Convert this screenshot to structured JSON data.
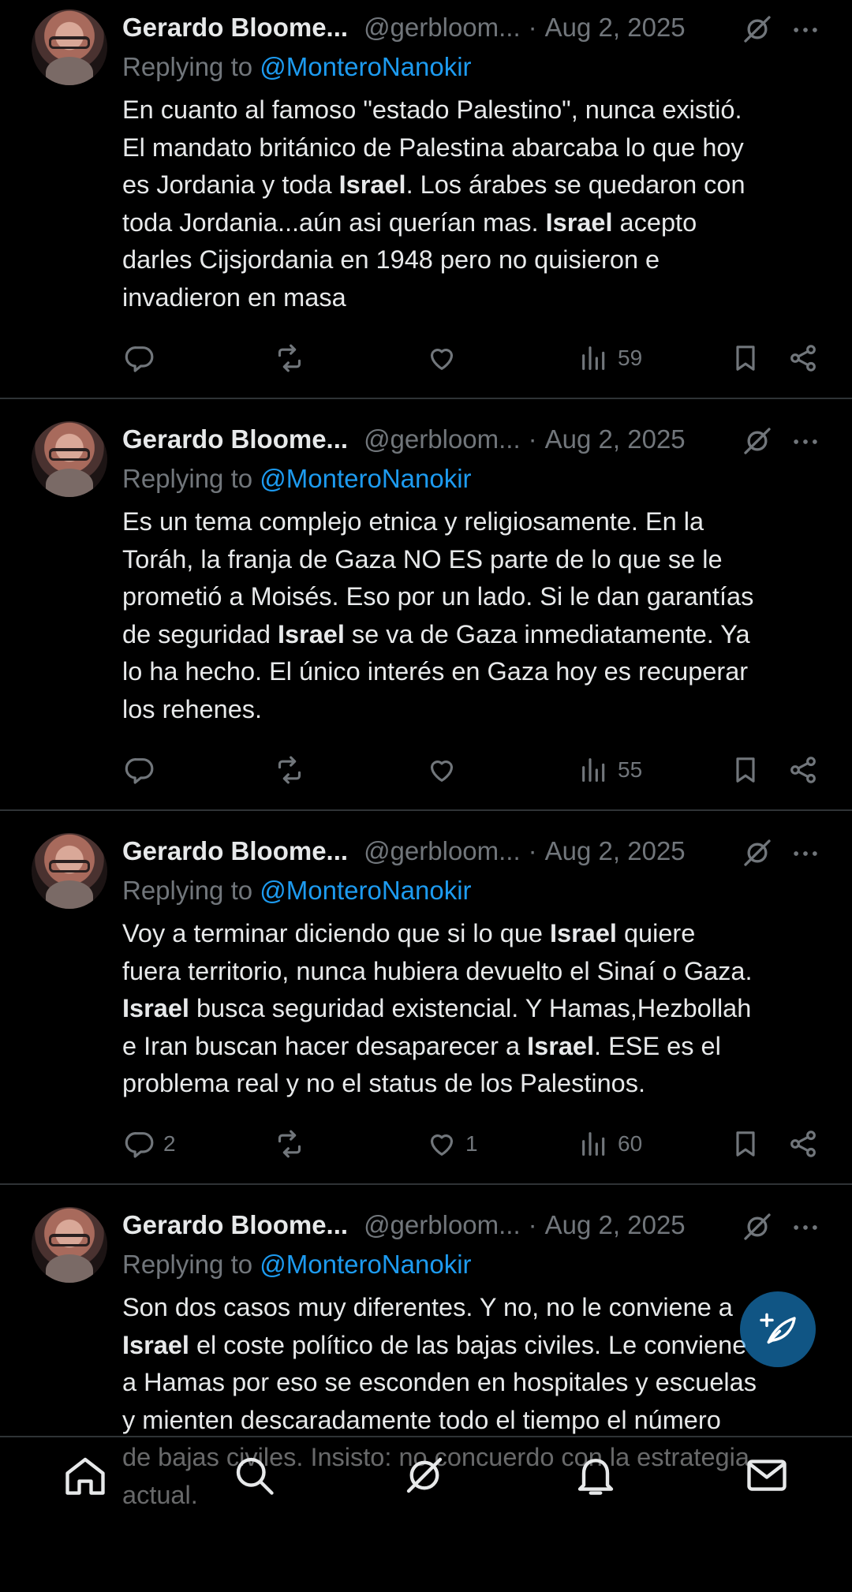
{
  "tweets": [
    {
      "name": "Gerardo Bloome...",
      "handle": "@gerbloom...",
      "date": "Aug 2, 2025",
      "replying_prefix": "Replying to ",
      "replying_to": "@MonteroNanokir",
      "lines": [
        [
          "En cuanto al famoso \"estado Palestino\", nunca existió."
        ],
        [
          "El mandato británico de Palestina abarcaba lo que hoy"
        ],
        [
          "es Jordania y toda ",
          "Israel",
          ". Los árabes se quedaron con"
        ],
        [
          "toda Jordania...aún asi querían mas. ",
          "Israel",
          " acepto"
        ],
        [
          "darles Cijsjordania en 1948 pero no quisieron e"
        ],
        [
          "invadieron en masa"
        ]
      ],
      "replies": "",
      "retweets": "",
      "likes": "",
      "views": "59"
    },
    {
      "name": "Gerardo Bloome...",
      "handle": "@gerbloom...",
      "date": "Aug 2, 2025",
      "replying_prefix": "Replying to ",
      "replying_to": "@MonteroNanokir",
      "lines": [
        [
          "Es un tema complejo etnica y religiosamente. En la"
        ],
        [
          "Toráh, la franja de Gaza NO ES parte de lo que se le"
        ],
        [
          "prometió a Moisés. Eso por un lado. Si le dan garantías"
        ],
        [
          "de seguridad ",
          "Israel",
          " se va de Gaza inmediatamente. Ya"
        ],
        [
          "lo ha hecho. El único interés en Gaza hoy es recuperar"
        ],
        [
          "los rehenes."
        ]
      ],
      "replies": "",
      "retweets": "",
      "likes": "",
      "views": "55"
    },
    {
      "name": "Gerardo Bloome...",
      "handle": "@gerbloom...",
      "date": "Aug 2, 2025",
      "replying_prefix": "Replying to ",
      "replying_to": "@MonteroNanokir",
      "lines": [
        [
          "Voy a terminar diciendo que si lo que ",
          "Israel",
          " quiere"
        ],
        [
          "fuera territorio, nunca hubiera devuelto el Sinaí o Gaza."
        ],
        [
          "",
          "Israel",
          " busca seguridad existencial. Y Hamas,Hezbollah"
        ],
        [
          "e Iran buscan hacer desaparecer a ",
          "Israel",
          ". ESE es el"
        ],
        [
          "problema real y no el status de los Palestinos."
        ]
      ],
      "replies": "2",
      "retweets": "",
      "likes": "1",
      "views": "60"
    },
    {
      "name": "Gerardo Bloome...",
      "handle": "@gerbloom...",
      "date": "Aug 2, 2025",
      "replying_prefix": "Replying to ",
      "replying_to": "@MonteroNanokir",
      "lines": [
        [
          "Son dos casos muy diferentes. Y no, no le conviene a"
        ],
        [
          "",
          "Israel",
          " el coste político de las bajas civiles. Le conviene"
        ],
        [
          "a Hamas por eso se esconden en hospitales y escuelas"
        ],
        [
          "y mienten descaradamente todo el tiempo el número"
        ],
        [
          "de bajas civiles. Insisto: no concuerdo con la estrategia"
        ],
        [
          "actual."
        ]
      ],
      "replies": "",
      "retweets": "",
      "likes": "",
      "views": ""
    }
  ],
  "colors": {
    "background": "#000000",
    "text": "#e7e9ea",
    "muted": "#71767b",
    "link": "#1d9bf0",
    "divider": "#2f3336"
  },
  "icons": {
    "reply": "reply-icon",
    "retweet": "retweet-icon",
    "like": "heart-icon",
    "views": "views-icon",
    "bookmark": "bookmark-icon",
    "share": "share-icon",
    "grok": "grok-icon",
    "more": "more-icon",
    "compose": "compose-icon",
    "nav": [
      "home-icon",
      "search-icon",
      "grok-icon",
      "notifications-icon",
      "messages-icon"
    ]
  }
}
